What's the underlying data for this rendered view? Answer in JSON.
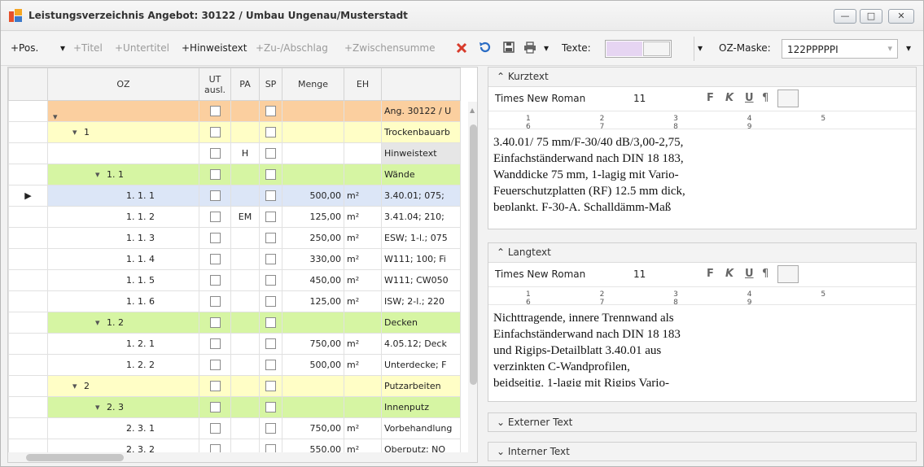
{
  "window": {
    "title": "Leistungsverzeichnis Angebot: 30122 / Umbau Ungenau/Musterstadt",
    "btn_min": "—",
    "btn_max": "□",
    "btn_close": "✕"
  },
  "toolbar": {
    "pos": "+Pos.",
    "dropdown": "▾",
    "titel": "+Titel",
    "untertitel": "+Untertitel",
    "hinweistext": "+Hinweistext",
    "zuabschlag": "+Zu-/Abschlag",
    "zwischensumme": "+Zwischensumme",
    "texte_label": "Texte:",
    "oz_label": "OZ-Maske:",
    "oz_value": "122PPPPPI"
  },
  "grid": {
    "headers": {
      "oz": "OZ",
      "ut": "UT ausl.",
      "pa": "PA",
      "sp": "SP",
      "menge": "Menge",
      "eh": "EH"
    },
    "rows": [
      {
        "oz": "",
        "ut": "",
        "pa": "",
        "sp": "",
        "menge": "",
        "eh": "",
        "kurz": "Ang. 30122 / U"
      },
      {
        "oz": "1",
        "pa": "",
        "menge": "",
        "eh": "",
        "kurz": "Trockenbauarb"
      },
      {
        "oz": "",
        "pa": "H",
        "menge": "",
        "eh": "",
        "kurz": "Hinweistext"
      },
      {
        "oz": "1. 1",
        "pa": "",
        "menge": "",
        "eh": "",
        "kurz": "Wände"
      },
      {
        "oz": "1. 1.  1",
        "pa": "",
        "menge": "500,00",
        "eh": "m²",
        "kurz": "3.40.01; 075;"
      },
      {
        "oz": "1. 1.  2",
        "pa": "EM",
        "menge": "125,00",
        "eh": "m²",
        "kurz": "3.41.04; 210;"
      },
      {
        "oz": "1. 1.  3",
        "pa": "",
        "menge": "250,00",
        "eh": "m²",
        "kurz": "ESW; 1-l.; 075"
      },
      {
        "oz": "1. 1.  4",
        "pa": "",
        "menge": "330,00",
        "eh": "m²",
        "kurz": "W111; 100; Fi"
      },
      {
        "oz": "1. 1.  5",
        "pa": "",
        "menge": "450,00",
        "eh": "m²",
        "kurz": "W111; CW050"
      },
      {
        "oz": "1. 1.  6",
        "pa": "",
        "menge": "125,00",
        "eh": "m²",
        "kurz": "ISW; 2-l.; 220"
      },
      {
        "oz": "1. 2",
        "pa": "",
        "menge": "",
        "eh": "",
        "kurz": "Decken"
      },
      {
        "oz": "1. 2.  1",
        "pa": "",
        "menge": "750,00",
        "eh": "m²",
        "kurz": "4.05.12; Deck"
      },
      {
        "oz": "1. 2.  2",
        "pa": "",
        "menge": "500,00",
        "eh": "m²",
        "kurz": "Unterdecke; F"
      },
      {
        "oz": "2",
        "pa": "",
        "menge": "",
        "eh": "",
        "kurz": "Putzarbeiten"
      },
      {
        "oz": "2. 3",
        "pa": "",
        "menge": "",
        "eh": "",
        "kurz": "Innenputz"
      },
      {
        "oz": "2. 3.  1",
        "pa": "",
        "menge": "750,00",
        "eh": "m²",
        "kurz": "Vorbehandlung"
      },
      {
        "oz": "2. 3.  2",
        "pa": "",
        "menge": "550,00",
        "eh": "m²",
        "kurz": "Oberputz; NO"
      }
    ]
  },
  "kurztext": {
    "header": "Kurztext",
    "font": "Times New Roman",
    "size": "11",
    "ruler": "1 2 3 4 5 6 7 8 9",
    "text": "3.40.01/ 75 mm/F-30/40 dB/3,00-2,75,\nEinfachständerwand nach DIN 18 183,\nWanddicke 75 mm, 1-lagig mit Vario-\nFeuerschutzplatten (RF) 12.5 mm dick,\nbeplankt, F-30-A, Schalldämm-Maß"
  },
  "langtext": {
    "header": "Langtext",
    "font": "Times New Roman",
    "size": "11",
    "text": "Nichttragende, innere Trennwand als\nEinfachständerwand nach DIN 18 183\nund Rigips-Detailblatt 3.40.01 aus\nverzinkten C-Wandprofilen,\nbeidseitig, 1-lagig mit Rigips Vario-"
  },
  "fmt": {
    "bold": "F",
    "italic": "K",
    "underline": "U",
    "para": "¶"
  },
  "externer": {
    "header": "Externer Text"
  },
  "interner": {
    "header": "Interner Text"
  },
  "colors": {
    "orange": "#fbcf9f",
    "yellow": "#fffec6",
    "green": "#d6f5a3",
    "selected": "#dce6f7",
    "delete_red": "#d83b2b"
  }
}
